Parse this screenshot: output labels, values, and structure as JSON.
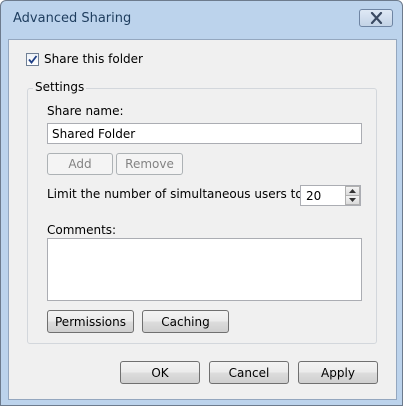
{
  "window": {
    "title": "Advanced Sharing"
  },
  "icons": {
    "close": "close-icon",
    "checkmark": "checkmark-icon",
    "spin_up": "up-arrow-icon",
    "spin_down": "down-arrow-icon"
  },
  "share": {
    "checkbox_label": "Share this folder",
    "checked": true
  },
  "settings": {
    "group_label": "Settings",
    "share_name_label": "Share name:",
    "share_name_value": "Shared Folder",
    "add_label": "Add",
    "remove_label": "Remove",
    "limit_label": "Limit the number of simultaneous users to:",
    "limit_value": "20",
    "comments_label": "Comments:",
    "comments_value": "",
    "permissions_label": "Permissions",
    "caching_label": "Caching"
  },
  "footer": {
    "ok_label": "OK",
    "cancel_label": "Cancel",
    "apply_label": "Apply"
  },
  "colors": {
    "frame": "#bcd3ec",
    "client": "#f0f0f0",
    "title_text": "#1e3d5e",
    "checkmark": "#1f3f86"
  }
}
